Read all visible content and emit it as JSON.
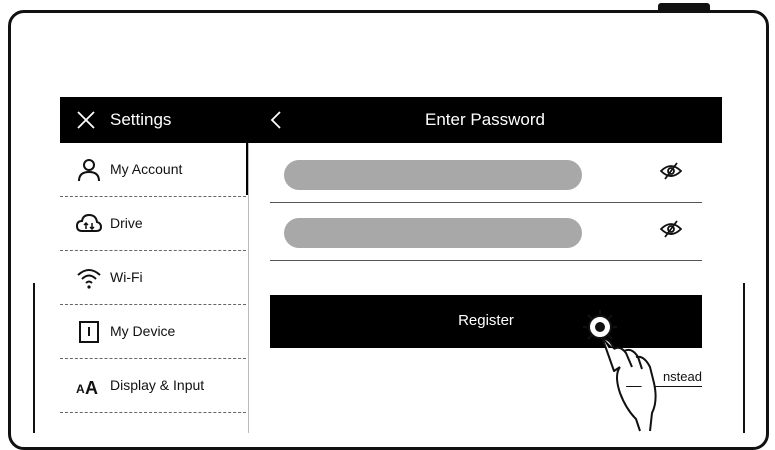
{
  "header": {
    "settings_title": "Settings",
    "page_title": "Enter Password"
  },
  "sidebar": {
    "items": [
      {
        "label": "My Account",
        "icon": "user-icon",
        "selected": true
      },
      {
        "label": "Drive",
        "icon": "cloud-icon"
      },
      {
        "label": "Wi-Fi",
        "icon": "wifi-icon"
      },
      {
        "label": "My Device",
        "icon": "device-icon"
      },
      {
        "label": "Display & Input",
        "icon": "font-size-icon"
      }
    ]
  },
  "form": {
    "password_field_icon": "eye-off-icon",
    "confirm_field_icon": "eye-off-icon",
    "register_label": "Register",
    "alt_link_label": "nstead"
  },
  "colors": {
    "bar_background": "#000000",
    "field_fill": "#a8a8a8",
    "text": "#111111"
  }
}
